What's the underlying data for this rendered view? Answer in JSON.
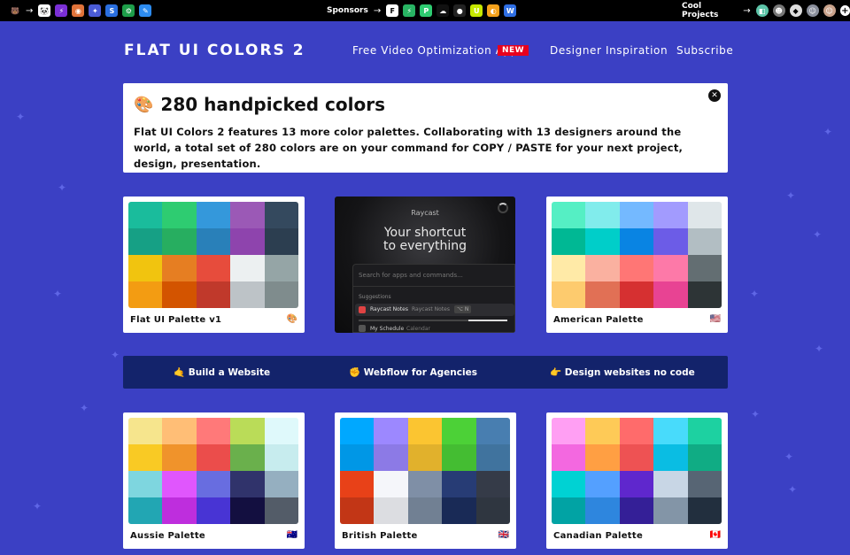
{
  "topbar": {
    "left_icons": [
      {
        "name": "bear-icon",
        "glyph": "🐻",
        "color": "#000000"
      },
      {
        "name": "panda-icon",
        "glyph": "🐼",
        "color": "#ffffff"
      },
      {
        "name": "bolt-icon",
        "glyph": "⚡",
        "color": "#7b2fd6"
      },
      {
        "name": "colorwheel-icon",
        "glyph": "◉",
        "color": "#e0733a"
      },
      {
        "name": "sparkle-icon",
        "glyph": "✦",
        "color": "#4a5bd6"
      },
      {
        "name": "s-app-icon",
        "glyph": "S",
        "color": "#2a6fe0"
      },
      {
        "name": "gear-app-icon",
        "glyph": "⚙",
        "color": "#1e9e4a"
      },
      {
        "name": "blue-app-icon",
        "glyph": "✎",
        "color": "#2d8cf0"
      }
    ],
    "sponsors_label": "Sponsors",
    "sponsor_icons": [
      {
        "name": "framer-icon",
        "glyph": "F",
        "color": "#ffffff"
      },
      {
        "name": "green-bolt-icon",
        "glyph": "⚡",
        "color": "#28b463"
      },
      {
        "name": "p-icon",
        "glyph": "P",
        "color": "#2ecc71"
      },
      {
        "name": "cloud-icon",
        "glyph": "☁",
        "color": "#111111"
      },
      {
        "name": "red-dot-icon",
        "glyph": "●",
        "color": "#222222"
      },
      {
        "name": "u-icon",
        "glyph": "U",
        "color": "#c6e800"
      },
      {
        "name": "orange-icon",
        "glyph": "◐",
        "color": "#f4a11b"
      },
      {
        "name": "webflow-icon",
        "glyph": "W",
        "color": "#2f6fe4"
      }
    ],
    "cool_label": "Cool Projects",
    "cool_icons": [
      {
        "name": "teal-project-icon",
        "glyph": "◧",
        "color": "#5cc4a8"
      },
      {
        "name": "avatar-project-icon",
        "glyph": "☻",
        "color": "#777777"
      },
      {
        "name": "bird-project-icon",
        "glyph": "◆",
        "color": "#dddddd"
      },
      {
        "name": "face-project-icon",
        "glyph": "☺",
        "color": "#8a8f9c"
      },
      {
        "name": "person-project-icon",
        "glyph": "☺",
        "color": "#c9a28b"
      }
    ],
    "plus": "+"
  },
  "header": {
    "logo": "FLAT UI COLORS 2",
    "nav": [
      "Free Video Optimization App",
      "Designer Inspiration",
      "Subscribe"
    ],
    "badge": "NEW",
    "badge_color": "#e8001d"
  },
  "intro": {
    "emoji": "🎨",
    "title": "280 handpicked colors",
    "text": "Flat UI Colors 2 features 13 more color palettes. Collaborating with 13 designers around the world, a total set of 280 colors are on your command for COPY / PASTE for your next project, design, presentation.",
    "close": "✕"
  },
  "ad": {
    "brand": "Raycast",
    "headline_1": "Your shortcut",
    "headline_2": "to everything",
    "search_placeholder": "Search for apps and commands...",
    "suggestions": "Suggestions",
    "row1_title": "Raycast Notes",
    "row1_sub": "Raycast Notes",
    "row1_keys": "⌥ N",
    "row2_title": "My Schedule",
    "row2_sub": "Calendar"
  },
  "links": [
    "🤙 Build a Website",
    "✊ Webflow for Agencies",
    "👉 Design websites no code"
  ],
  "palettes": [
    {
      "name": "Flat UI Palette v1",
      "flag": "🎨",
      "colors": [
        "#1abc9c",
        "#2ecc71",
        "#3498db",
        "#9b59b6",
        "#34495e",
        "#16a085",
        "#27ae60",
        "#2980b9",
        "#8e44ad",
        "#2c3e50",
        "#f1c40f",
        "#e67e22",
        "#e74c3c",
        "#ecf0f1",
        "#95a5a6",
        "#f39c12",
        "#d35400",
        "#c0392b",
        "#bdc3c7",
        "#7f8c8d"
      ]
    },
    {
      "name": "American Palette",
      "flag": "🇺🇸",
      "colors": [
        "#55efc4",
        "#81ecec",
        "#74b9ff",
        "#a29bfe",
        "#dfe6e9",
        "#00b894",
        "#00cec9",
        "#0984e3",
        "#6c5ce7",
        "#b2bec3",
        "#ffeaa7",
        "#fab1a0",
        "#ff7675",
        "#fd79a8",
        "#636e72",
        "#fdcb6e",
        "#e17055",
        "#d63031",
        "#e84393",
        "#2d3436"
      ]
    },
    {
      "name": "Aussie Palette",
      "flag": "🇦🇺",
      "colors": [
        "#f6e58d",
        "#ffbe76",
        "#ff7979",
        "#badc58",
        "#dff9fb",
        "#f9ca24",
        "#f0932b",
        "#eb4d4b",
        "#6ab04c",
        "#c7ecee",
        "#7ed6df",
        "#e056fd",
        "#686de0",
        "#30336b",
        "#95afc0",
        "#22a6b3",
        "#be2edd",
        "#4834d4",
        "#130f40",
        "#535c68"
      ]
    },
    {
      "name": "British Palette",
      "flag": "🇬🇧",
      "colors": [
        "#00a8ff",
        "#9c88ff",
        "#fbc531",
        "#4cd137",
        "#487eb0",
        "#0097e6",
        "#8c7ae6",
        "#e1b12c",
        "#44bd32",
        "#40739e",
        "#e84118",
        "#f5f6fa",
        "#7f8fa6",
        "#273c75",
        "#353b48",
        "#c23616",
        "#dcdde1",
        "#718093",
        "#192a56",
        "#2f3640"
      ]
    },
    {
      "name": "Canadian Palette",
      "flag": "🇨🇦",
      "colors": [
        "#ff9ff3",
        "#feca57",
        "#ff6b6b",
        "#48dbfb",
        "#1dd1a1",
        "#f368e0",
        "#ff9f43",
        "#ee5253",
        "#0abde3",
        "#10ac84",
        "#00d2d3",
        "#54a0ff",
        "#5f27cd",
        "#c8d6e5",
        "#576574",
        "#01a3a4",
        "#2e86de",
        "#341f97",
        "#8395a7",
        "#222f3e"
      ]
    }
  ]
}
